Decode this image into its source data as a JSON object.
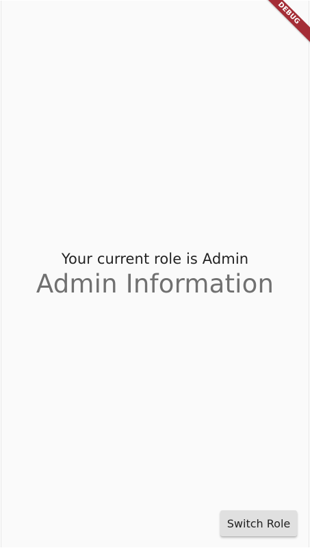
{
  "main": {
    "role_text": "Your current role is Admin",
    "info_title": "Admin Information"
  },
  "actions": {
    "switch_role_label": "Switch Role"
  },
  "banner": {
    "debug_label": "DEBUG",
    "color": "#a42d36"
  },
  "colors": {
    "background": "#fafafa",
    "button": "#e0e0e0",
    "title_text": "#707070",
    "body_text": "#222222"
  }
}
